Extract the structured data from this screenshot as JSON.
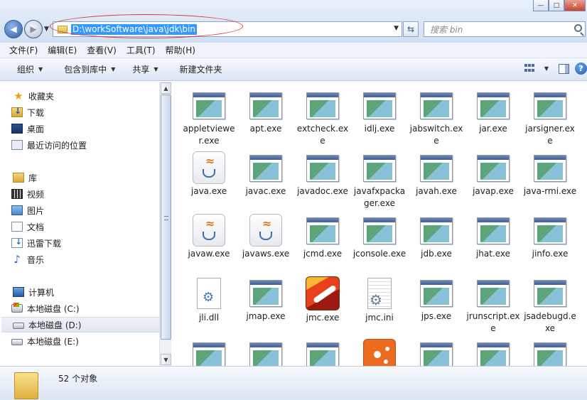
{
  "address": {
    "path": "D:\\workSoftware\\java\\jdk\\bin"
  },
  "search": {
    "placeholder": "搜索 bin"
  },
  "menu": [
    "文件(F)",
    "编辑(E)",
    "查看(V)",
    "工具(T)",
    "帮助(H)"
  ],
  "toolbar": {
    "organize": "组织",
    "include": "包含到库中",
    "share": "共享",
    "new_folder": "新建文件夹"
  },
  "nav": {
    "favorites": "收藏夹",
    "downloads": "下载",
    "desktop": "桌面",
    "recent": "最近访问的位置",
    "libraries": "库",
    "videos": "视频",
    "pictures": "图片",
    "documents": "文档",
    "thunder": "迅雷下载",
    "music": "音乐",
    "computer": "计算机",
    "drive_c": "本地磁盘 (C:)",
    "drive_d": "本地磁盘 (D:)",
    "drive_e": "本地磁盘 (E:)"
  },
  "files": [
    {
      "name": "appletviewer.exe",
      "icon": "exe-icon"
    },
    {
      "name": "apt.exe",
      "icon": "exe-icon"
    },
    {
      "name": "extcheck.exe",
      "icon": "exe-icon"
    },
    {
      "name": "idlj.exe",
      "icon": "exe-icon"
    },
    {
      "name": "jabswitch.exe",
      "icon": "exe-icon"
    },
    {
      "name": "jar.exe",
      "icon": "exe-icon"
    },
    {
      "name": "jarsigner.exe",
      "icon": "exe-icon"
    },
    {
      "name": "java.exe",
      "icon": "java-icon"
    },
    {
      "name": "javac.exe",
      "icon": "exe-icon"
    },
    {
      "name": "javadoc.exe",
      "icon": "exe-icon"
    },
    {
      "name": "javafxpackager.exe",
      "icon": "exe-icon"
    },
    {
      "name": "javah.exe",
      "icon": "exe-icon"
    },
    {
      "name": "javap.exe",
      "icon": "exe-icon"
    },
    {
      "name": "java-rmi.exe",
      "icon": "exe-icon"
    },
    {
      "name": "javaw.exe",
      "icon": "java-icon"
    },
    {
      "name": "javaws.exe",
      "icon": "java-icon"
    },
    {
      "name": "jcmd.exe",
      "icon": "exe-icon"
    },
    {
      "name": "jconsole.exe",
      "icon": "exe-icon"
    },
    {
      "name": "jdb.exe",
      "icon": "exe-icon"
    },
    {
      "name": "jhat.exe",
      "icon": "exe-icon"
    },
    {
      "name": "jinfo.exe",
      "icon": "exe-icon"
    },
    {
      "name": "jli.dll",
      "icon": "dll-icon"
    },
    {
      "name": "jmap.exe",
      "icon": "exe-icon"
    },
    {
      "name": "jmc.exe",
      "icon": "jmc-icon"
    },
    {
      "name": "jmc.ini",
      "icon": "ini-icon"
    },
    {
      "name": "jps.exe",
      "icon": "exe-icon"
    },
    {
      "name": "jrunscript.exe",
      "icon": "exe-icon"
    },
    {
      "name": "jsadebugd.exe",
      "icon": "exe-icon"
    },
    {
      "name": "",
      "icon": "exe-icon"
    },
    {
      "name": "",
      "icon": "exe-icon"
    },
    {
      "name": "",
      "icon": "exe-icon"
    },
    {
      "name": "",
      "icon": "visualvm-icon"
    },
    {
      "name": "",
      "icon": "exe-icon"
    },
    {
      "name": "",
      "icon": "exe-icon"
    },
    {
      "name": "",
      "icon": "exe-icon"
    }
  ],
  "status": {
    "count": "52 个对象"
  }
}
